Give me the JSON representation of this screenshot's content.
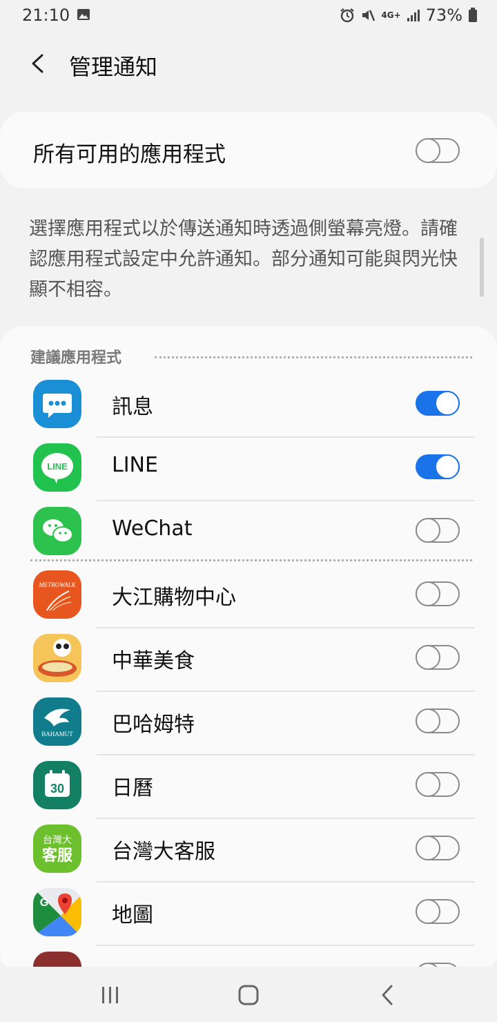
{
  "status_bar": {
    "time": "21:10",
    "network": "4G+",
    "battery": "73%"
  },
  "header": {
    "title": "管理通知"
  },
  "master": {
    "label": "所有可用的應用程式",
    "enabled": false
  },
  "description": "選擇應用程式以於傳送通知時透過側螢幕亮燈。請確認應用程式設定中允許通知。部分通知可能與閃光快顯不相容。",
  "apps_section": {
    "title": "建議應用程式",
    "apps": [
      {
        "name": "訊息",
        "enabled": true,
        "icon": "messages-icon",
        "color": "#1a8fd6"
      },
      {
        "name": "LINE",
        "enabled": true,
        "icon": "line-icon",
        "color": "#06c755"
      },
      {
        "name": "WeChat",
        "enabled": false,
        "icon": "wechat-icon",
        "color": "#2dc100"
      },
      {
        "name": "大江購物中心",
        "enabled": false,
        "icon": "metrowalk-icon",
        "color": "#e8561f"
      },
      {
        "name": "中華美食",
        "enabled": false,
        "icon": "chinese-food-icon",
        "color": "#f3a43a"
      },
      {
        "name": "巴哈姆特",
        "enabled": false,
        "icon": "bahamut-icon",
        "color": "#117d8c"
      },
      {
        "name": "日曆",
        "enabled": false,
        "icon": "calendar-icon",
        "color": "#138063"
      },
      {
        "name": "台灣大客服",
        "enabled": false,
        "icon": "taiwan-mobile-service-icon",
        "color": "#6cbf2d"
      },
      {
        "name": "地圖",
        "enabled": false,
        "icon": "google-maps-icon",
        "color": "#34a853"
      }
    ]
  },
  "icon_text": {
    "messages": "•••",
    "line": "LINE",
    "metrowalk": "METROWALK",
    "bahamut": "BAHAMUT",
    "calendar": "30",
    "taiwan_service_top": "台灣大",
    "taiwan_service_bottom": "客服",
    "maps": "G"
  }
}
